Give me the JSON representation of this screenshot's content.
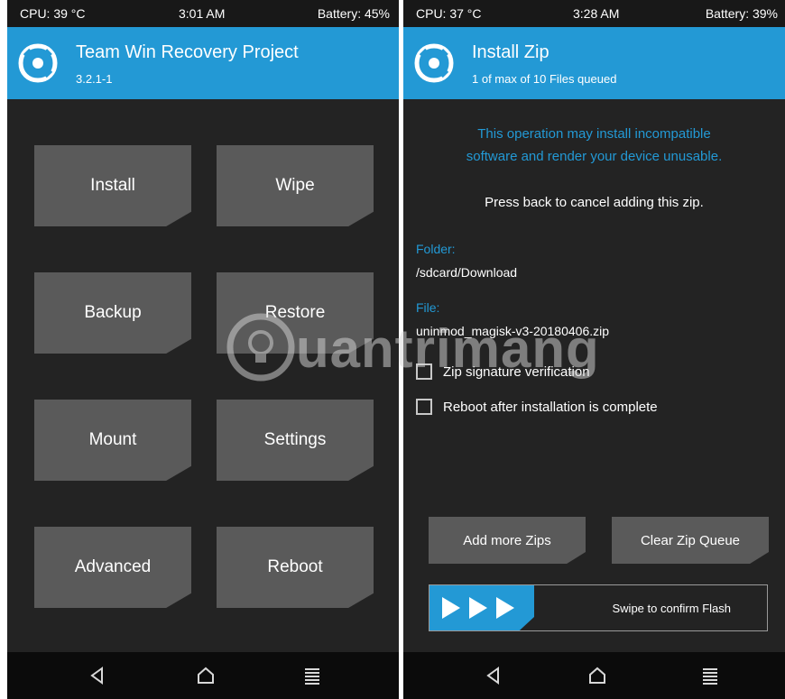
{
  "left": {
    "status": {
      "cpu": "CPU: 39 °C",
      "time": "3:01 AM",
      "battery": "Battery: 45%"
    },
    "header": {
      "title": "Team Win Recovery Project",
      "subtitle": "3.2.1-1"
    },
    "menu": [
      "Install",
      "Wipe",
      "Backup",
      "Restore",
      "Mount",
      "Settings",
      "Advanced",
      "Reboot"
    ]
  },
  "right": {
    "status": {
      "cpu": "CPU: 37 °C",
      "time": "3:28 AM",
      "battery": "Battery: 39%"
    },
    "header": {
      "title": "Install Zip",
      "subtitle": "1 of max of 10 Files queued"
    },
    "warning": [
      "This operation may install incompatible",
      "software and render your device unusable."
    ],
    "cancel_note": "Press back to cancel adding this zip.",
    "folder_label": "Folder:",
    "folder_value": "/sdcard/Download",
    "file_label": "File:",
    "file_value": "uninmod_magisk-v3-20180406.zip",
    "checkboxes": [
      {
        "label": "Zip signature verification",
        "checked": false
      },
      {
        "label": "Reboot after installation is complete",
        "checked": false
      }
    ],
    "buttons": {
      "add_more": "Add more Zips",
      "clear_queue": "Clear Zip Queue"
    },
    "swipe_text": "Swipe to confirm Flash"
  },
  "nav_icons": [
    "back-icon",
    "home-icon",
    "menu-icon"
  ],
  "watermark": "uantrimang",
  "colors": {
    "accent": "#2399d5",
    "background": "#232323",
    "button": "#5a5a5a",
    "statusbar": "#181818",
    "navbar": "#0b0b0b"
  }
}
